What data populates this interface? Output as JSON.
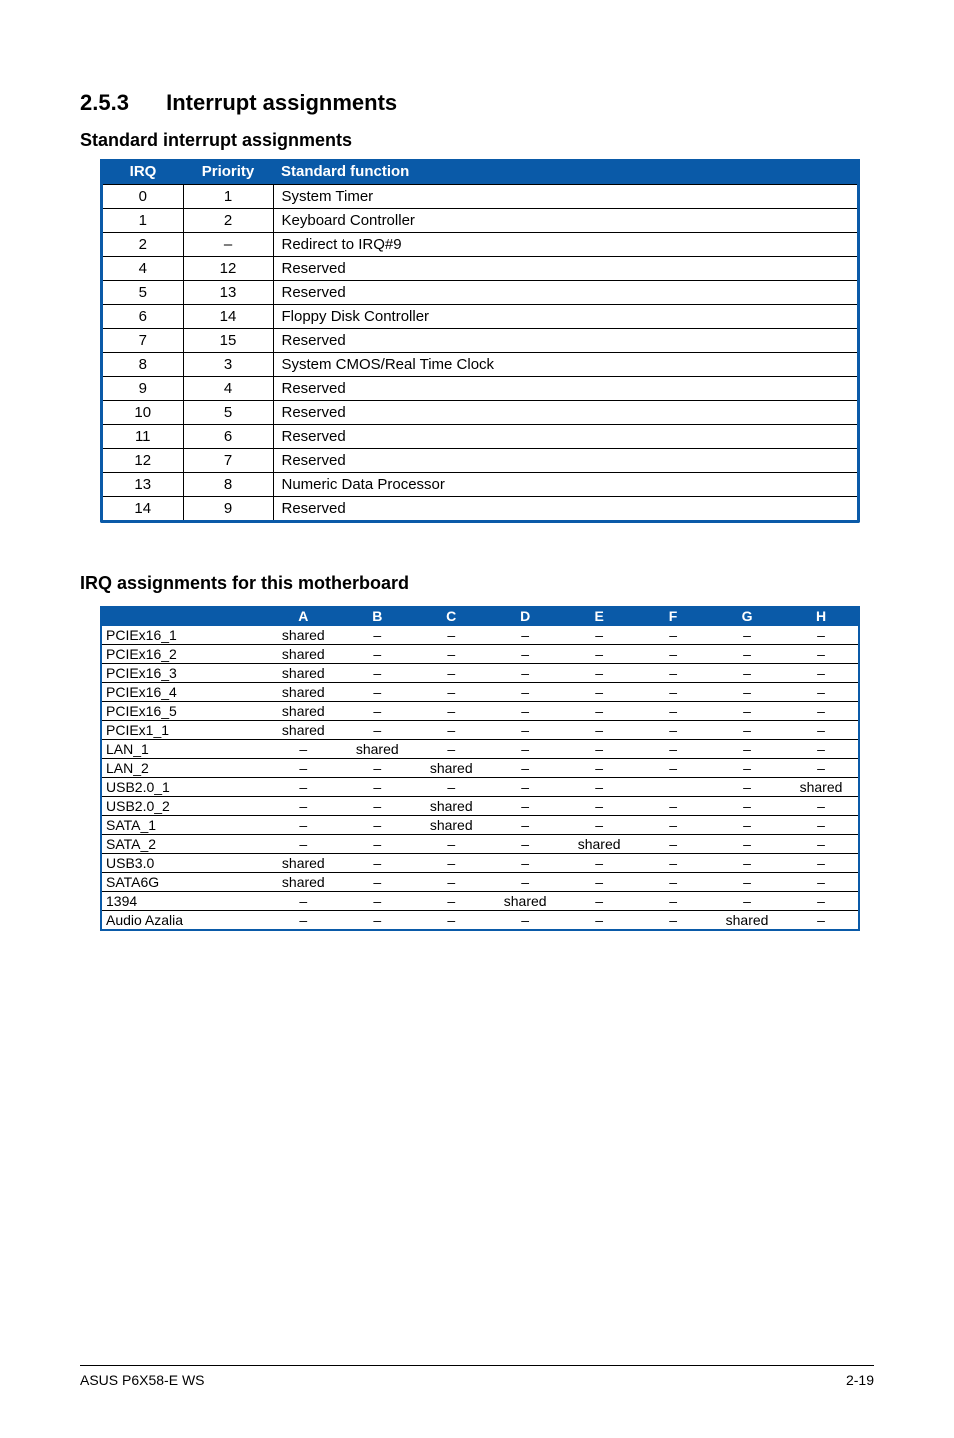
{
  "section": {
    "number": "2.5.3",
    "title": "Interrupt assignments"
  },
  "sub1": "Standard interrupt assignments",
  "sub2": "IRQ assignments for this motherboard",
  "t1": {
    "headers": {
      "irq": "IRQ",
      "priority": "Priority",
      "func": "Standard function"
    },
    "rows": [
      {
        "irq": "0",
        "pri": "1",
        "func": "System Timer"
      },
      {
        "irq": "1",
        "pri": "2",
        "func": "Keyboard Controller"
      },
      {
        "irq": "2",
        "pri": "–",
        "func": "Redirect to IRQ#9"
      },
      {
        "irq": "4",
        "pri": "12",
        "func": "Reserved"
      },
      {
        "irq": "5",
        "pri": "13",
        "func": "Reserved"
      },
      {
        "irq": "6",
        "pri": "14",
        "func": "Floppy Disk Controller"
      },
      {
        "irq": "7",
        "pri": "15",
        "func": "Reserved"
      },
      {
        "irq": "8",
        "pri": "3",
        "func": "System CMOS/Real Time Clock"
      },
      {
        "irq": "9",
        "pri": "4",
        "func": "Reserved"
      },
      {
        "irq": "10",
        "pri": "5",
        "func": "Reserved"
      },
      {
        "irq": "11",
        "pri": "6",
        "func": "Reserved"
      },
      {
        "irq": "12",
        "pri": "7",
        "func": "Reserved"
      },
      {
        "irq": "13",
        "pri": "8",
        "func": "Numeric Data Processor"
      },
      {
        "irq": "14",
        "pri": "9",
        "func": "Reserved"
      }
    ]
  },
  "t2": {
    "cols": [
      "A",
      "B",
      "C",
      "D",
      "E",
      "F",
      "G",
      "H"
    ],
    "rows": [
      {
        "label": "PCIEx16_1",
        "cells": [
          "shared",
          "–",
          "–",
          "–",
          "–",
          "–",
          "–",
          "–"
        ]
      },
      {
        "label": "PCIEx16_2",
        "cells": [
          "shared",
          "–",
          "–",
          "–",
          "–",
          "–",
          "–",
          "–"
        ]
      },
      {
        "label": "PCIEx16_3",
        "cells": [
          "shared",
          "–",
          "–",
          "–",
          "–",
          "–",
          "–",
          "–"
        ]
      },
      {
        "label": "PCIEx16_4",
        "cells": [
          "shared",
          "–",
          "–",
          "–",
          "–",
          "–",
          "–",
          "–"
        ]
      },
      {
        "label": "PCIEx16_5",
        "cells": [
          "shared",
          "–",
          "–",
          "–",
          "–",
          "–",
          "–",
          "–"
        ]
      },
      {
        "label": "PCIEx1_1",
        "cells": [
          "shared",
          "–",
          "–",
          "–",
          "–",
          "–",
          "–",
          "–"
        ]
      },
      {
        "label": "LAN_1",
        "cells": [
          "–",
          "shared",
          "–",
          "–",
          "–",
          "–",
          "–",
          "–"
        ]
      },
      {
        "label": "LAN_2",
        "cells": [
          "–",
          "–",
          "shared",
          "–",
          "–",
          "–",
          "–",
          "–"
        ]
      },
      {
        "label": "USB2.0_1",
        "cells": [
          "–",
          "–",
          "–",
          "–",
          "–",
          "",
          "–",
          "shared"
        ]
      },
      {
        "label": "USB2.0_2",
        "cells": [
          "–",
          "–",
          "shared",
          "–",
          "–",
          "–",
          "–",
          "–"
        ]
      },
      {
        "label": "SATA_1",
        "cells": [
          "–",
          "–",
          "shared",
          "–",
          "–",
          "–",
          "–",
          "–"
        ]
      },
      {
        "label": "SATA_2",
        "cells": [
          "–",
          "–",
          "–",
          "–",
          "shared",
          "–",
          "–",
          "–"
        ]
      },
      {
        "label": "USB3.0",
        "cells": [
          "shared",
          "–",
          "–",
          "–",
          "–",
          "–",
          "–",
          "–"
        ]
      },
      {
        "label": "SATA6G",
        "cells": [
          "shared",
          "–",
          "–",
          "–",
          "–",
          "–",
          "–",
          "–"
        ]
      },
      {
        "label": "1394",
        "cells": [
          "–",
          "–",
          "–",
          "shared",
          "–",
          "–",
          "–",
          "–"
        ]
      },
      {
        "label": "Audio Azalia",
        "cells": [
          "–",
          "–",
          "–",
          "–",
          "–",
          "–",
          "shared",
          "–"
        ]
      }
    ]
  },
  "footer": {
    "left": "ASUS P6X58-E WS",
    "right": "2-19"
  },
  "chart_data": [
    {
      "type": "table",
      "title": "Standard interrupt assignments",
      "columns": [
        "IRQ",
        "Priority",
        "Standard function"
      ],
      "rows": [
        [
          "0",
          "1",
          "System Timer"
        ],
        [
          "1",
          "2",
          "Keyboard Controller"
        ],
        [
          "2",
          "–",
          "Redirect to IRQ#9"
        ],
        [
          "4",
          "12",
          "Reserved"
        ],
        [
          "5",
          "13",
          "Reserved"
        ],
        [
          "6",
          "14",
          "Floppy Disk Controller"
        ],
        [
          "7",
          "15",
          "Reserved"
        ],
        [
          "8",
          "3",
          "System CMOS/Real Time Clock"
        ],
        [
          "9",
          "4",
          "Reserved"
        ],
        [
          "10",
          "5",
          "Reserved"
        ],
        [
          "11",
          "6",
          "Reserved"
        ],
        [
          "12",
          "7",
          "Reserved"
        ],
        [
          "13",
          "8",
          "Numeric Data Processor"
        ],
        [
          "14",
          "9",
          "Reserved"
        ]
      ]
    },
    {
      "type": "table",
      "title": "IRQ assignments for this motherboard",
      "columns": [
        "",
        "A",
        "B",
        "C",
        "D",
        "E",
        "F",
        "G",
        "H"
      ],
      "rows": [
        [
          "PCIEx16_1",
          "shared",
          "–",
          "–",
          "–",
          "–",
          "–",
          "–",
          "–"
        ],
        [
          "PCIEx16_2",
          "shared",
          "–",
          "–",
          "–",
          "–",
          "–",
          "–",
          "–"
        ],
        [
          "PCIEx16_3",
          "shared",
          "–",
          "–",
          "–",
          "–",
          "–",
          "–",
          "–"
        ],
        [
          "PCIEx16_4",
          "shared",
          "–",
          "–",
          "–",
          "–",
          "–",
          "–",
          "–"
        ],
        [
          "PCIEx16_5",
          "shared",
          "–",
          "–",
          "–",
          "–",
          "–",
          "–",
          "–"
        ],
        [
          "PCIEx1_1",
          "shared",
          "–",
          "–",
          "–",
          "–",
          "–",
          "–",
          "–"
        ],
        [
          "LAN_1",
          "–",
          "shared",
          "–",
          "–",
          "–",
          "–",
          "–",
          "–"
        ],
        [
          "LAN_2",
          "–",
          "–",
          "shared",
          "–",
          "–",
          "–",
          "–",
          "–"
        ],
        [
          "USB2.0_1",
          "–",
          "–",
          "–",
          "–",
          "–",
          "",
          "–",
          "shared"
        ],
        [
          "USB2.0_2",
          "–",
          "–",
          "shared",
          "–",
          "–",
          "–",
          "–",
          "–"
        ],
        [
          "SATA_1",
          "–",
          "–",
          "shared",
          "–",
          "–",
          "–",
          "–",
          "–"
        ],
        [
          "SATA_2",
          "–",
          "–",
          "–",
          "–",
          "shared",
          "–",
          "–",
          "–"
        ],
        [
          "USB3.0",
          "shared",
          "–",
          "–",
          "–",
          "–",
          "–",
          "–",
          "–"
        ],
        [
          "SATA6G",
          "shared",
          "–",
          "–",
          "–",
          "–",
          "–",
          "–",
          "–"
        ],
        [
          "1394",
          "–",
          "–",
          "–",
          "shared",
          "–",
          "–",
          "–",
          "–"
        ],
        [
          "Audio Azalia",
          "–",
          "–",
          "–",
          "–",
          "–",
          "–",
          "shared",
          "–"
        ]
      ]
    }
  ]
}
